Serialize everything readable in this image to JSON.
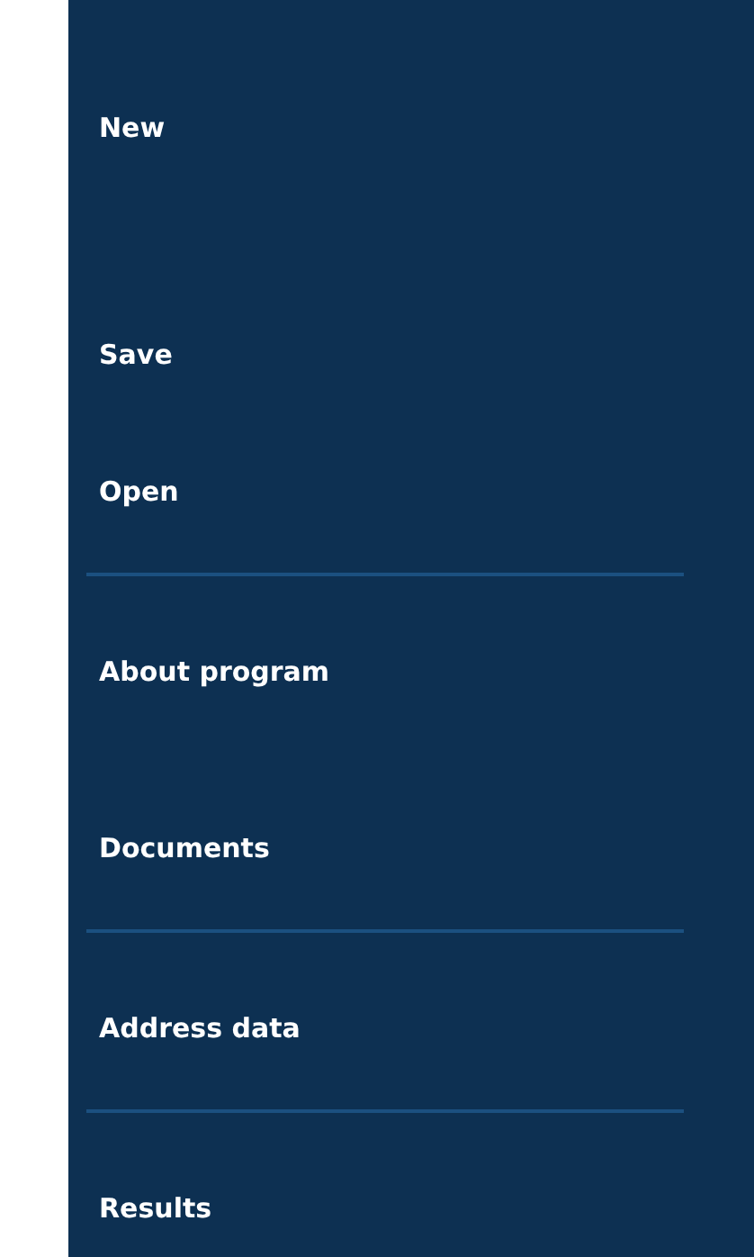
{
  "menu": {
    "groups": [
      {
        "items": [
          {
            "label": "New"
          },
          {
            "label": "Save"
          },
          {
            "label": "Open"
          }
        ]
      },
      {
        "items": [
          {
            "label": "About program"
          },
          {
            "label": "Documents"
          }
        ]
      },
      {
        "items": [
          {
            "label": "Address data"
          }
        ]
      },
      {
        "items": [
          {
            "label": "Results"
          }
        ]
      }
    ]
  }
}
